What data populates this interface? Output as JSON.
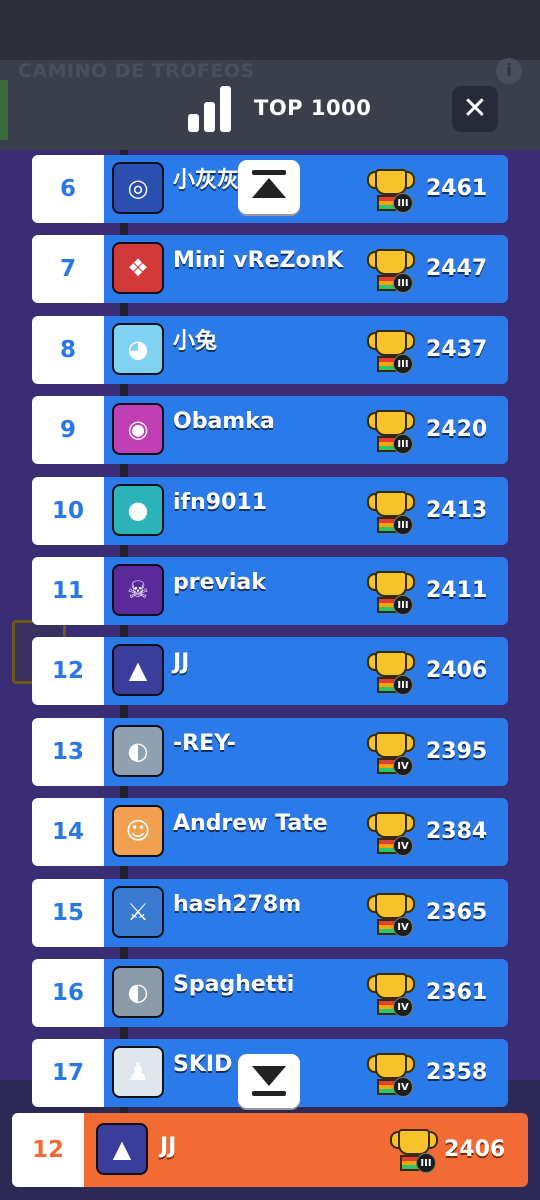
{
  "background": {
    "title": "CAMINO DE TROFEOS",
    "info_icon": "i"
  },
  "header": {
    "icon": "leaderboard-bars-icon",
    "title": "TOP 1000",
    "close_icon": "close-icon",
    "close_glyph": "✕"
  },
  "rows": [
    {
      "rank": "6",
      "name": "小灰灰",
      "score": "2461",
      "tier": "III",
      "avatar_color": "#2b4fb0",
      "avatar_glyph": "◎"
    },
    {
      "rank": "7",
      "name": "Mini vReZonK",
      "score": "2447",
      "tier": "III",
      "avatar_color": "#d23a3a",
      "avatar_glyph": "❖"
    },
    {
      "rank": "8",
      "name": "小兔",
      "score": "2437",
      "tier": "III",
      "avatar_color": "#7fd3f0",
      "avatar_glyph": "◕"
    },
    {
      "rank": "9",
      "name": "Obamka",
      "score": "2420",
      "tier": "III",
      "avatar_color": "#c13fb5",
      "avatar_glyph": "◉"
    },
    {
      "rank": "10",
      "name": "ifn9011",
      "score": "2413",
      "tier": "III",
      "avatar_color": "#2bb3b8",
      "avatar_glyph": "●"
    },
    {
      "rank": "11",
      "name": "previak",
      "score": "2411",
      "tier": "III",
      "avatar_color": "#5b2a9a",
      "avatar_glyph": "☠"
    },
    {
      "rank": "12",
      "name": "JJ",
      "score": "2406",
      "tier": "III",
      "avatar_color": "#3a3e9a",
      "avatar_glyph": "▲"
    },
    {
      "rank": "13",
      "name": "-REY-",
      "score": "2395",
      "tier": "IV",
      "avatar_color": "#8fa0b0",
      "avatar_glyph": "◐"
    },
    {
      "rank": "14",
      "name": "Andrew Tate",
      "score": "2384",
      "tier": "IV",
      "avatar_color": "#f0a050",
      "avatar_glyph": "☺"
    },
    {
      "rank": "15",
      "name": "hash278m",
      "score": "2365",
      "tier": "IV",
      "avatar_color": "#3a7ad0",
      "avatar_glyph": "⚔"
    },
    {
      "rank": "16",
      "name": "Spaghetti",
      "score": "2361",
      "tier": "IV",
      "avatar_color": "#8a9aa8",
      "avatar_glyph": "◐"
    },
    {
      "rank": "17",
      "name": "SKID",
      "score": "2358",
      "tier": "IV",
      "avatar_color": "#e0e6ee",
      "avatar_glyph": "♟"
    }
  ],
  "own_row": {
    "rank": "12",
    "name": "JJ",
    "score": "2406",
    "tier": "III",
    "avatar_color": "#3a3e9a",
    "avatar_glyph": "▲"
  },
  "scroll": {
    "up_icon": "scroll-to-top-icon",
    "down_icon": "scroll-to-bottom-icon"
  }
}
